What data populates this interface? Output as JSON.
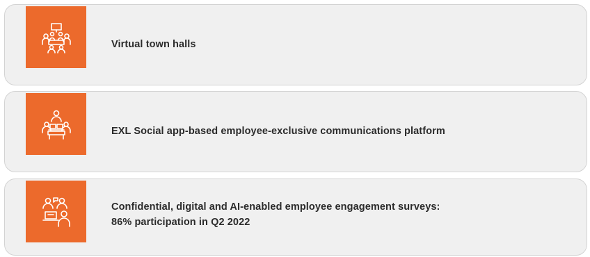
{
  "items": [
    {
      "icon": "people-around-screen-icon",
      "text": "Virtual town halls"
    },
    {
      "icon": "team-with-laptops-icon",
      "text": "EXL Social app-based employee-exclusive communications platform"
    },
    {
      "icon": "team-survey-laptop-icon",
      "lines": [
        "Confidential, digital and AI-enabled employee engagement surveys:",
        "86% participation in Q2 2022"
      ]
    }
  ],
  "colors": {
    "icon_background": "#ec6a2c",
    "card_background": "#f0f0f0",
    "card_border": "#d3d3d3",
    "text": "#2b2b2b"
  }
}
